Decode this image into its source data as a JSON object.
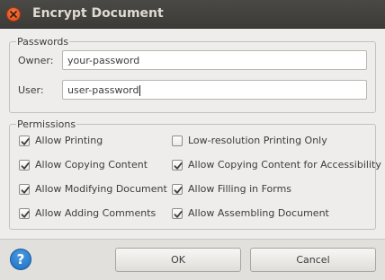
{
  "window": {
    "title": "Encrypt Document"
  },
  "passwords": {
    "legend": "Passwords",
    "owner_label": "Owner:",
    "owner_value": "your-password",
    "user_label": "User:",
    "user_value": "user-password"
  },
  "permissions": {
    "legend": "Permissions",
    "items": [
      {
        "label": "Allow Printing",
        "checked": true
      },
      {
        "label": "Low-resolution Printing Only",
        "checked": false
      },
      {
        "label": "Allow Copying Content",
        "checked": true
      },
      {
        "label": "Allow Copying Content for Accessibility",
        "checked": true
      },
      {
        "label": "Allow Modifying Document",
        "checked": true
      },
      {
        "label": "Allow Filling in Forms",
        "checked": true
      },
      {
        "label": "Allow Adding Comments",
        "checked": true
      },
      {
        "label": "Allow Assembling Document",
        "checked": true
      }
    ]
  },
  "footer": {
    "help_icon": "?",
    "ok_label": "OK",
    "cancel_label": "Cancel"
  },
  "colors": {
    "titlebar": "#3c3b37",
    "close_button": "#df4a16",
    "help_button": "#1d6fc4"
  }
}
